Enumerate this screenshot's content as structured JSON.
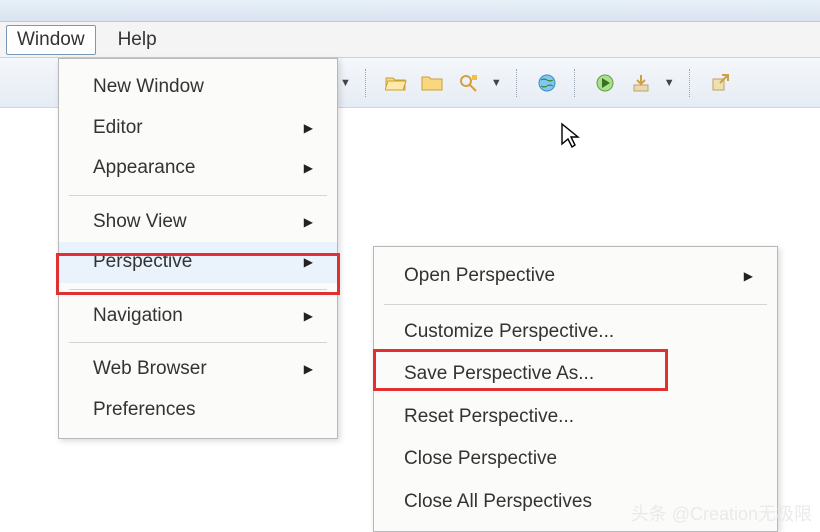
{
  "menubar": {
    "window": "Window",
    "help": "Help"
  },
  "window_menu": {
    "new_window": "New Window",
    "editor": "Editor",
    "appearance": "Appearance",
    "show_view": "Show View",
    "perspective": "Perspective",
    "navigation": "Navigation",
    "web_browser": "Web Browser",
    "preferences": "Preferences"
  },
  "perspective_menu": {
    "open_perspective": "Open Perspective",
    "customize": "Customize Perspective...",
    "save_as": "Save Perspective As...",
    "reset": "Reset Perspective...",
    "close": "Close Perspective",
    "close_all": "Close All Perspectives"
  },
  "toolbar": {
    "icons": [
      "folder-open-icon",
      "folder-icon",
      "search-icon",
      "globe-icon",
      "run-icon",
      "download-icon",
      "external-link-icon"
    ]
  },
  "watermark": "头条 @Creation无极限"
}
